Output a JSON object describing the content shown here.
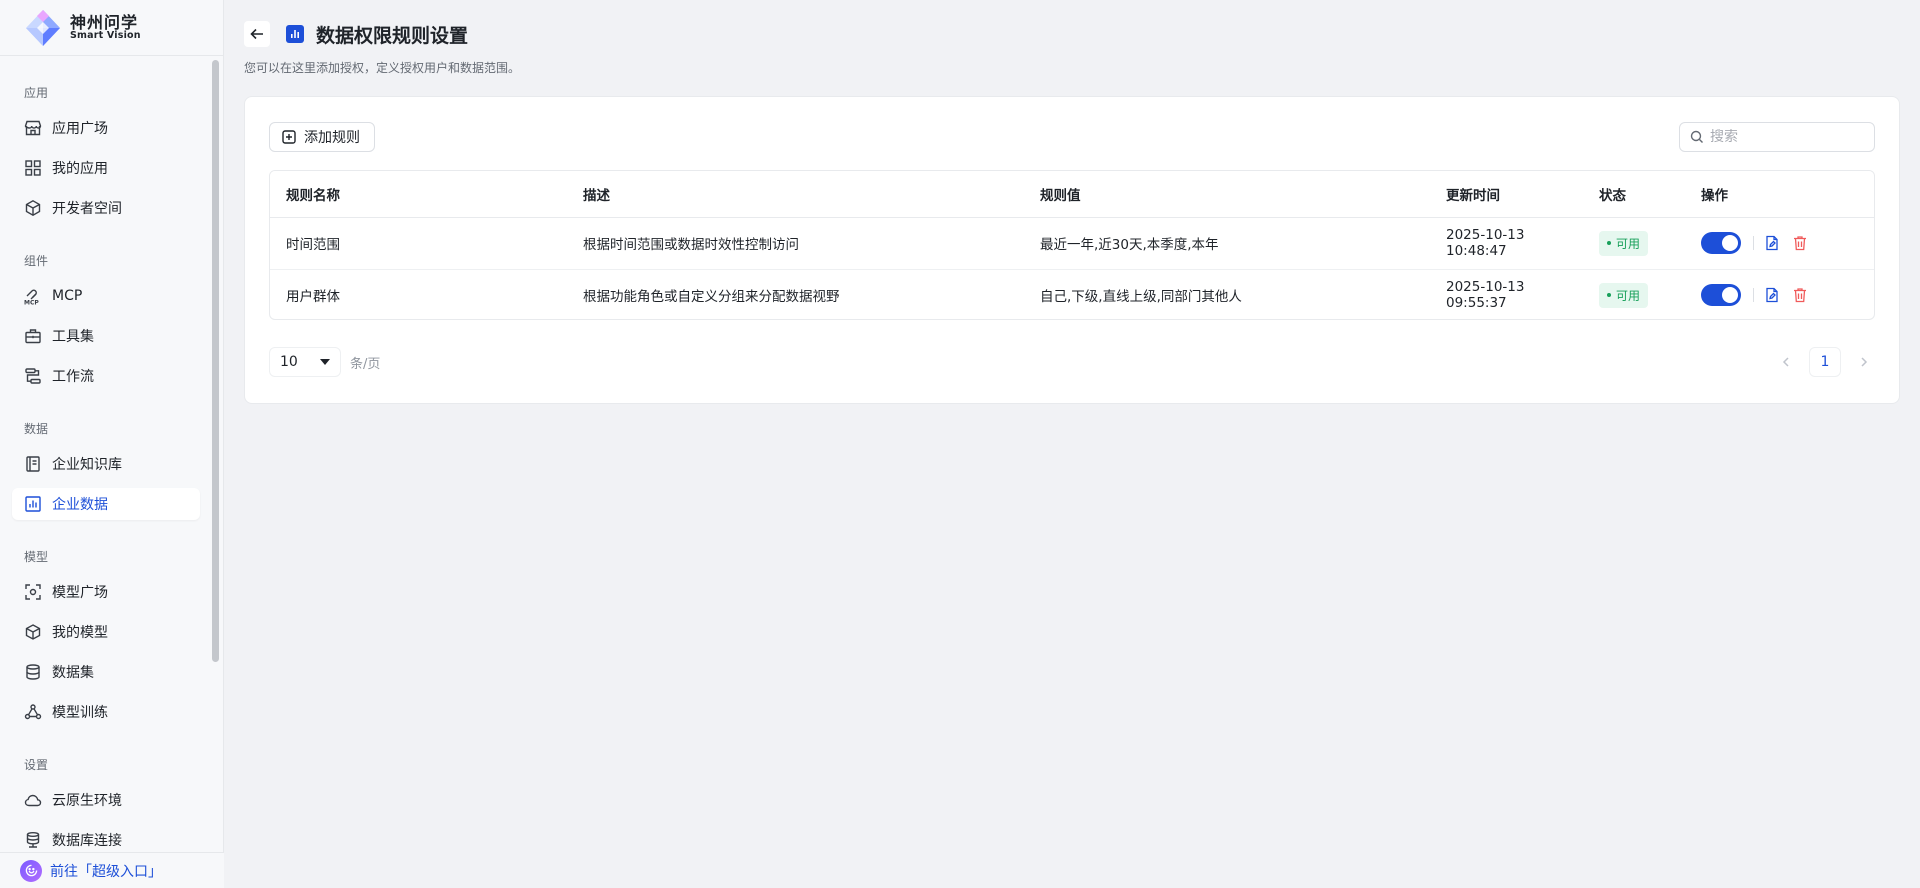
{
  "brand": {
    "name": "神州问学",
    "sub": "Smart Vision"
  },
  "sidebar": {
    "groups": [
      {
        "title": "应用",
        "items": [
          {
            "label": "应用广场",
            "icon": "store-icon"
          },
          {
            "label": "我的应用",
            "icon": "grid-icon"
          },
          {
            "label": "开发者空间",
            "icon": "cube-network-icon"
          }
        ]
      },
      {
        "title": "组件",
        "items": [
          {
            "label": "MCP",
            "icon": "mcp-icon"
          },
          {
            "label": "工具集",
            "icon": "toolbox-icon"
          },
          {
            "label": "工作流",
            "icon": "workflow-icon"
          }
        ]
      },
      {
        "title": "数据",
        "items": [
          {
            "label": "企业知识库",
            "icon": "book-icon"
          },
          {
            "label": "企业数据",
            "icon": "bar-chart-icon",
            "active": true
          }
        ]
      },
      {
        "title": "模型",
        "items": [
          {
            "label": "模型广场",
            "icon": "scan-icon"
          },
          {
            "label": "我的模型",
            "icon": "box-icon"
          },
          {
            "label": "数据集",
            "icon": "database-icon"
          },
          {
            "label": "模型训练",
            "icon": "training-icon"
          }
        ]
      },
      {
        "title": "设置",
        "items": [
          {
            "label": "云原生环境",
            "icon": "cloud-icon"
          },
          {
            "label": "数据库连接",
            "icon": "db-link-icon"
          }
        ]
      }
    ],
    "footer_link": "前往「超级入口」"
  },
  "header": {
    "title": "数据权限规则设置",
    "subtitle": "您可以在这里添加授权，定义授权用户和数据范围。"
  },
  "toolbar": {
    "add_label": "添加规则",
    "search_placeholder": "搜索"
  },
  "table": {
    "columns": [
      "规则名称",
      "描述",
      "规则值",
      "更新时间",
      "状态",
      "操作"
    ],
    "rows": [
      {
        "name": "时间范围",
        "desc": "根据时间范围或数据时效性控制访问",
        "value": "最近一年,近30天,本季度,本年",
        "updated": "2025-10-13 10:48:47",
        "status": "可用",
        "enabled": true
      },
      {
        "name": "用户群体",
        "desc": "根据功能角色或自定义分组来分配数据视野",
        "value": "自己,下级,直线上级,同部门其他人",
        "updated": "2025-10-13 09:55:37",
        "status": "可用",
        "enabled": true
      }
    ]
  },
  "pagination": {
    "page_size": "10",
    "unit": "条/页",
    "current": "1"
  },
  "colors": {
    "accent": "#1d4fd8",
    "success": "#18a05a",
    "danger": "#f05a5a"
  }
}
